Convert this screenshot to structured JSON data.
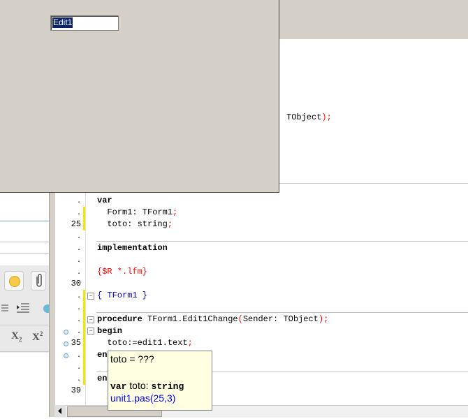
{
  "form": {
    "edit_value": "Edit1"
  },
  "code_lines": {
    "top_fragment": "TObject",
    "top_fragment_sym": ");",
    "var_kw": "var",
    "form1_decl": "  Form1: TForm1",
    "form1_sym": ";",
    "toto_decl": "  toto: string",
    "toto_sym": ";",
    "implementation_kw": "implementation",
    "directive": "{$R *.lfm}",
    "comment": "{ TForm1 }",
    "procedure_kw": "procedure",
    "procedure_name": " TForm1.Edit1Change",
    "proc_sym1": "(",
    "proc_args": "Sender: TObject",
    "proc_sym2": ");",
    "begin_kw": "begin",
    "assign_line": "  toto:=edit1.text",
    "assign_sym": ";",
    "end_partial1": "en",
    "end_partial2": "en"
  },
  "line_numbers": {
    "n25": "25",
    "n30": "30",
    "n35": "35",
    "n39": "39",
    "dot": "."
  },
  "hint": {
    "line1": "toto = ???",
    "line2_kw": "var",
    "line2_mid": " toto: ",
    "line2_type": "string",
    "line3": "unit1.pas(25,3)"
  },
  "left_toolbar": {
    "subscript_label": "X",
    "subscript_small": "2",
    "superscript_label": "X",
    "superscript_small": "2"
  },
  "colors": {
    "form_bg": "#d4d0c8",
    "hint_bg": "#ffffe1",
    "selection": "#0a246a",
    "symbol_red": "#ff0000",
    "comment_blue": "#0000cc",
    "hint_link_blue": "#0000ff"
  }
}
